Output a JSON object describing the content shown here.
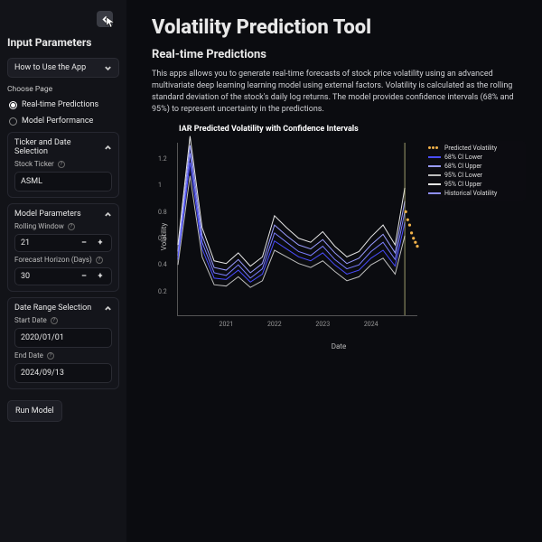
{
  "sidebar": {
    "title": "Input Parameters",
    "how_to": "How to Use the App",
    "choose_page_label": "Choose Page",
    "pages": [
      "Real-time Predictions",
      "Model Performance"
    ],
    "selected_page": 0,
    "ticker_section": {
      "title": "Ticker and Date Selection",
      "ticker_label": "Stock Ticker",
      "ticker_value": "ASML"
    },
    "model_section": {
      "title": "Model Parameters",
      "rolling_label": "Rolling Window",
      "rolling_value": "21",
      "horizon_label": "Forecast Horizon (Days)",
      "horizon_value": "30"
    },
    "date_section": {
      "title": "Date Range Selection",
      "start_label": "Start Date",
      "start_value": "2020/01/01",
      "end_label": "End Date",
      "end_value": "2024/09/13"
    },
    "run_label": "Run Model"
  },
  "main": {
    "title": "Volatility Prediction Tool",
    "subtitle": "Real-time Predictions",
    "intro": "This apps allows you to generate real-time forecasts of stock price volatility using an advanced multivariate deep learning learning model using external factors. Volatility is calculated as the rolling standard deviation of the stock's daily log returns. The model provides confidence intervals (68% and 95%) to represent uncertainty in the predictions.",
    "chart_title": "IAR Predicted Volatility with Confidence Intervals",
    "xlabel": "Date",
    "ylabel": "Volatility",
    "legend": {
      "pred": "Predicted Volatility",
      "ci68l": "68% CI Lower",
      "ci68u": "68% CI Upper",
      "ci95l": "95% CI Lower",
      "ci95u": "95% CI Upper",
      "hist": "Historical Volatility"
    },
    "yticks": [
      "0.2",
      "0.4",
      "0.6",
      "0.8",
      "1",
      "1.2"
    ],
    "xticks": [
      "2021",
      "2022",
      "2023",
      "2024"
    ]
  },
  "chart_data": {
    "type": "line",
    "title": "IAR Predicted Volatility with Confidence Intervals",
    "xlabel": "Date",
    "ylabel": "Volatility",
    "ylim": [
      0,
      1.3
    ],
    "x_years": [
      2020.0,
      2020.25,
      2020.5,
      2020.75,
      2021.0,
      2021.25,
      2021.5,
      2021.75,
      2022.0,
      2022.25,
      2022.5,
      2022.75,
      2023.0,
      2023.25,
      2023.5,
      2023.75,
      2024.0,
      2024.25,
      2024.5,
      2024.7
    ],
    "series": [
      {
        "name": "Historical Volatility",
        "color": "#7a7dff",
        "values": [
          0.45,
          1.22,
          0.55,
          0.32,
          0.3,
          0.38,
          0.28,
          0.35,
          0.62,
          0.55,
          0.48,
          0.45,
          0.52,
          0.42,
          0.35,
          0.38,
          0.48,
          0.55,
          0.42,
          0.78
        ]
      },
      {
        "name": "68% CI Lower",
        "color": "#4a4dff",
        "values": [
          0.42,
          1.15,
          0.5,
          0.28,
          0.27,
          0.34,
          0.25,
          0.31,
          0.56,
          0.5,
          0.44,
          0.41,
          0.47,
          0.38,
          0.31,
          0.34,
          0.43,
          0.49,
          0.37,
          0.7
        ]
      },
      {
        "name": "68% CI Upper",
        "color": "#9a9cff",
        "values": [
          0.48,
          1.28,
          0.6,
          0.36,
          0.34,
          0.42,
          0.32,
          0.39,
          0.68,
          0.6,
          0.53,
          0.5,
          0.57,
          0.47,
          0.39,
          0.43,
          0.53,
          0.61,
          0.47,
          0.86
        ]
      },
      {
        "name": "95% CI Lower",
        "color": "#bdbdbd",
        "values": [
          0.38,
          1.05,
          0.44,
          0.23,
          0.22,
          0.29,
          0.21,
          0.26,
          0.49,
          0.44,
          0.39,
          0.36,
          0.41,
          0.33,
          0.26,
          0.29,
          0.38,
          0.43,
          0.31,
          0.6
        ]
      },
      {
        "name": "95% CI Upper",
        "color": "#e6e6e6",
        "values": [
          0.53,
          1.35,
          0.66,
          0.41,
          0.39,
          0.47,
          0.37,
          0.44,
          0.75,
          0.66,
          0.58,
          0.55,
          0.63,
          0.52,
          0.44,
          0.48,
          0.59,
          0.68,
          0.53,
          0.96
        ]
      }
    ],
    "predicted": {
      "name": "Predicted Volatility",
      "color": "#f1b24a",
      "x_years": [
        2024.72,
        2024.76,
        2024.8,
        2024.84,
        2024.88,
        2024.92,
        2024.96
      ],
      "values": [
        0.78,
        0.72,
        0.68,
        0.62,
        0.58,
        0.55,
        0.52
      ]
    }
  },
  "colors": {
    "ci68": "#5a5dff",
    "ci95": "#cfcfcf",
    "hist": "#8f90ff",
    "pred": "#f1b24a"
  }
}
